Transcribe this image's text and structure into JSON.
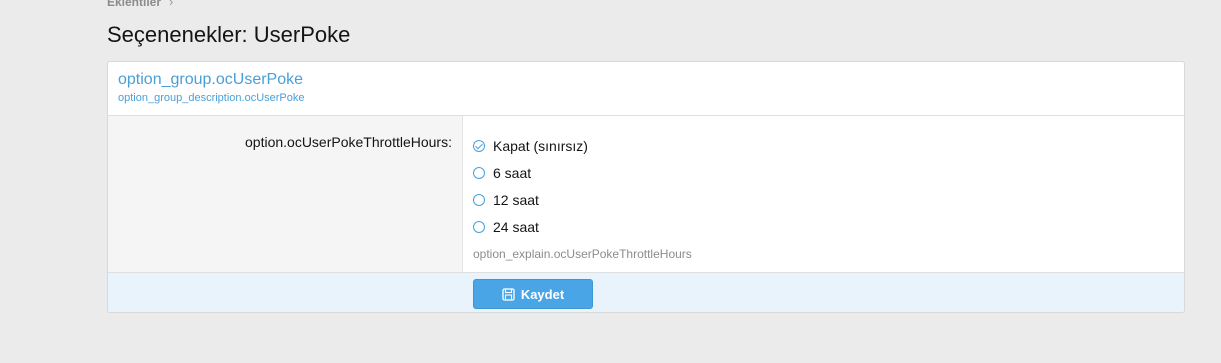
{
  "breadcrumb": {
    "item": "Eklentiler",
    "separator": "›"
  },
  "page": {
    "title": "Seçenenekler: UserPoke"
  },
  "option_group": {
    "title": "option_group.ocUserPoke",
    "description": "option_group_description.ocUserPoke"
  },
  "option": {
    "label": "option.ocUserPokeThrottleHours:",
    "choices": [
      {
        "label": "Kapat (sınırsız)",
        "selected": true
      },
      {
        "label": "6 saat",
        "selected": false
      },
      {
        "label": "12 saat",
        "selected": false
      },
      {
        "label": "24 saat",
        "selected": false
      }
    ],
    "explain": "option_explain.ocUserPokeThrottleHours"
  },
  "footer": {
    "save_label": "Kaydet",
    "save_icon": "floppy-disk-icon"
  },
  "colors": {
    "accent": "#4a9fd8",
    "button": "#4aa5e7",
    "footer_bg": "#e9f3fb",
    "page_bg": "#ebebeb"
  }
}
